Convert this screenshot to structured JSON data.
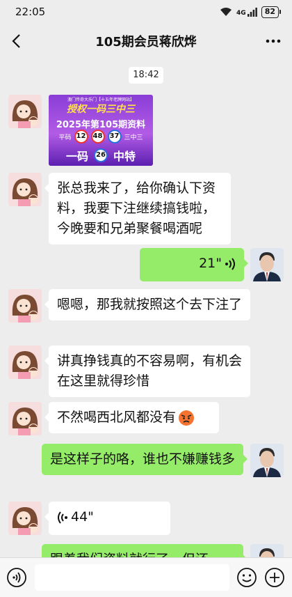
{
  "status": {
    "time": "22:05",
    "network": "4G",
    "battery": "82"
  },
  "header": {
    "title": "105期会员蒋欣烨"
  },
  "chat": {
    "timestamp": "18:42",
    "promo": {
      "top_text": "澳门传奇大乐门【十五年老牌网站】",
      "headline": "授权一码三中三",
      "period": "2025年第105期资料",
      "tag_left": "平码",
      "tag_right": "三中三",
      "balls": [
        "12",
        "48",
        "37"
      ],
      "bottom_left": "一码",
      "bottom_ball": "26",
      "bottom_right": "中特"
    },
    "messages": [
      {
        "text": "张总我来了，给你确认下资料，我要下注继续搞钱啦，今晚要和兄弟聚餐喝酒呢"
      },
      {
        "duration": "21\""
      },
      {
        "text": "嗯嗯，那我就按照这个去下注了"
      },
      {
        "text": "讲真挣钱真的不容易啊，有机会在这里就得珍惜"
      },
      {
        "text": "不然喝西北风都没有"
      },
      {
        "text": "是这样子的咯，谁也不嫌赚钱多"
      },
      {
        "duration": "44\""
      },
      {
        "text": "跟着我们资料就行了，但还"
      }
    ]
  },
  "input": {
    "placeholder": ""
  },
  "colors": {
    "bubble_green": "#95ec69",
    "background": "#ededed"
  }
}
